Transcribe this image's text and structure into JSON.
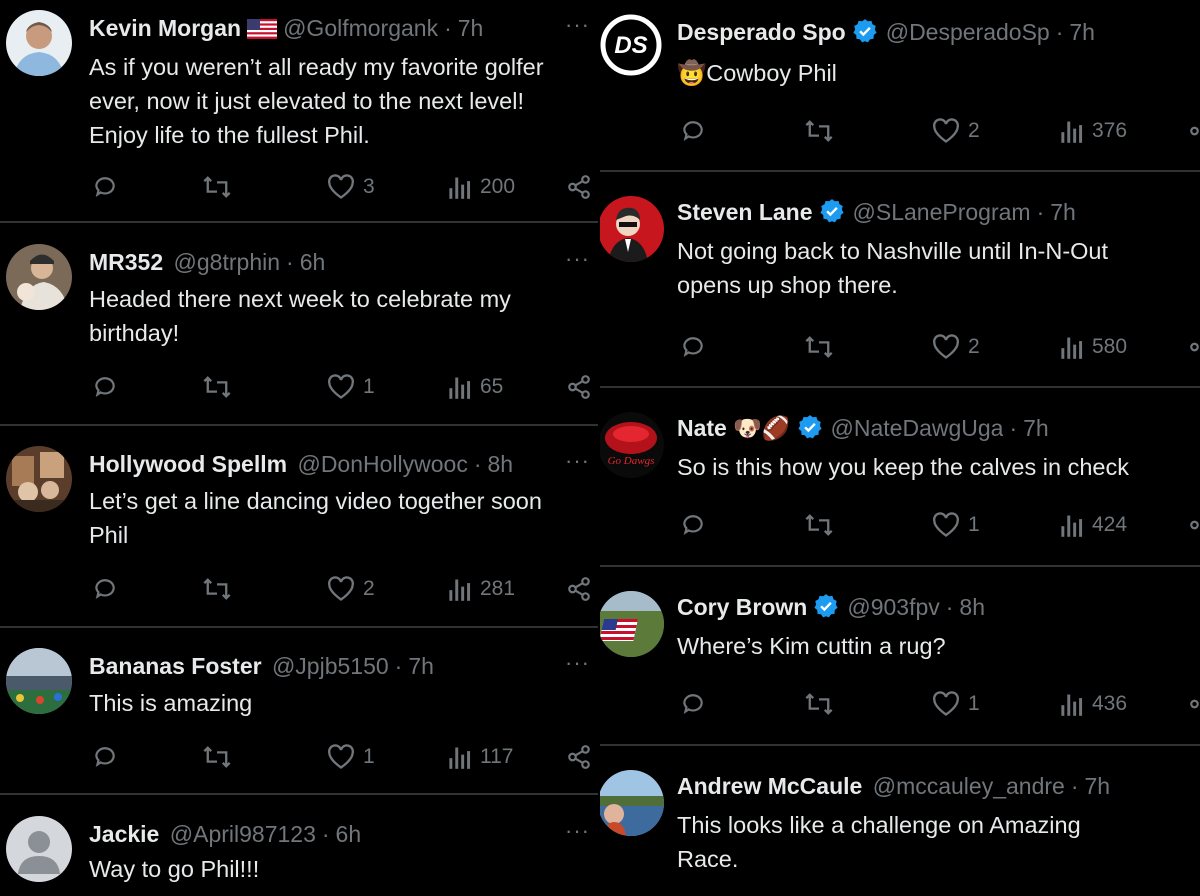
{
  "left_column": [
    {
      "name": "Kevin Morgan",
      "has_flag": true,
      "handle": "@Golfmorgank",
      "sep": "·",
      "time": "7h",
      "text_lines": [
        "As if you weren’t all ready my favorite golfer",
        "ever, now it just elevated to the next level!",
        "Enjoy life to the fullest Phil."
      ],
      "likes": "3",
      "views": "200",
      "avatar": "man-white-shirt"
    },
    {
      "name": "MR352",
      "handle": "@g8trphin",
      "sep": "·",
      "time": "6h",
      "text_lines": [
        "Headed there next week to celebrate my",
        "birthday!"
      ],
      "likes": "1",
      "views": "65",
      "avatar": "man-with-baby"
    },
    {
      "name": "Hollywood Spellm",
      "handle": "@DonHollywooc",
      "sep": "·",
      "time": "8h",
      "text_lines": [
        "Let’s get a line dancing video together soon",
        "Phil"
      ],
      "likes": "2",
      "views": "281",
      "avatar": "group-photo"
    },
    {
      "name": "Bananas Foster",
      "handle": "@Jpjb5150",
      "sep": "·",
      "time": "7h",
      "text_lines": [
        "This is amazing"
      ],
      "likes": "1",
      "views": "117",
      "avatar": "stadium"
    },
    {
      "name": "Jackie",
      "handle": "@April987123",
      "sep": "·",
      "time": "6h",
      "text_lines": [
        "Way to go Phil!!!"
      ],
      "avatar": "default-profile"
    }
  ],
  "right_column": [
    {
      "name": "Desperado Spo",
      "verified": true,
      "handle": "@DesperadoSp",
      "sep": "·",
      "time": "7h",
      "emoji": "🤠",
      "text_lines": [
        "Cowboy Phil"
      ],
      "likes": "2",
      "views": "376",
      "avatar": "ds-logo"
    },
    {
      "name": "Steven Lane",
      "verified": true,
      "handle": "@SLaneProgram",
      "sep": "·",
      "time": "7h",
      "text_lines": [
        "Not going back to Nashville until In-N-Out",
        "opens up shop there."
      ],
      "likes": "2",
      "views": "580",
      "avatar": "man-red-background"
    },
    {
      "name": "Nate",
      "emojis": "🐶🏈",
      "verified": true,
      "handle": "@NateDawgUga",
      "sep": "·",
      "time": "7h",
      "text_lines": [
        "So is this how you keep the calves in check"
      ],
      "likes": "1",
      "views": "424",
      "avatar": "red-logo"
    },
    {
      "name": "Cory Brown",
      "verified": true,
      "handle": "@903fpv",
      "sep": "·",
      "time": "8h",
      "text_lines": [
        "Where’s Kim cuttin a rug?"
      ],
      "likes": "1",
      "views": "436",
      "avatar": "flag-field"
    },
    {
      "name": "Andrew McCaule",
      "handle": "@mccauley_andre",
      "sep": "·",
      "time": "7h",
      "text_lines": [
        "This looks like a challenge on Amazing",
        "Race."
      ],
      "avatar": "man-lake"
    }
  ],
  "more_label": "···",
  "colors": {
    "background": "#000000",
    "text": "#e7e9ea",
    "muted": "#71767b",
    "verified": "#1d9bf0",
    "divider": "#2f3336"
  }
}
